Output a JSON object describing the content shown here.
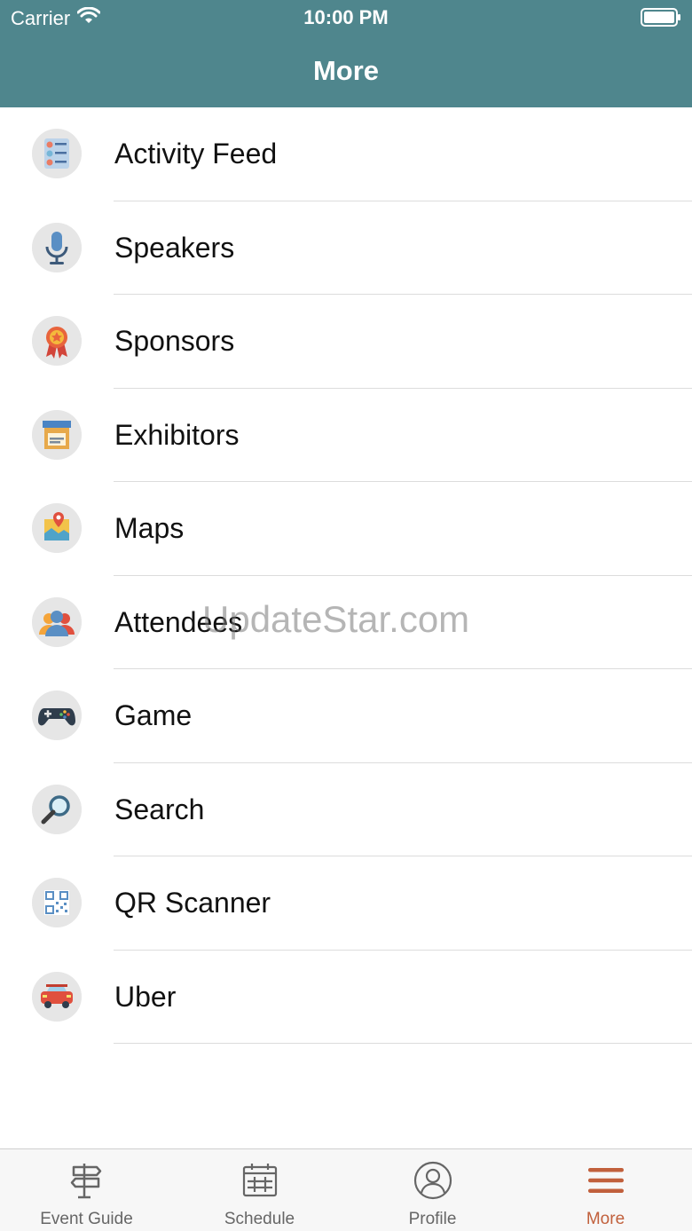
{
  "status_bar": {
    "carrier": "Carrier",
    "time": "10:00 PM"
  },
  "nav": {
    "title": "More"
  },
  "colors": {
    "header": "#4f868d",
    "active_tab": "#c1603c",
    "inactive_tab": "#666666"
  },
  "menu": {
    "items": [
      {
        "label": "Activity Feed",
        "icon": "activity-feed-icon"
      },
      {
        "label": "Speakers",
        "icon": "microphone-icon"
      },
      {
        "label": "Sponsors",
        "icon": "award-ribbon-icon"
      },
      {
        "label": "Exhibitors",
        "icon": "booth-icon"
      },
      {
        "label": "Maps",
        "icon": "map-pin-icon"
      },
      {
        "label": "Attendees",
        "icon": "people-icon"
      },
      {
        "label": "Game",
        "icon": "gamepad-icon"
      },
      {
        "label": "Search",
        "icon": "magnifier-icon"
      },
      {
        "label": "QR Scanner",
        "icon": "qr-code-icon"
      },
      {
        "label": "Uber",
        "icon": "car-icon"
      }
    ]
  },
  "watermark": "UpdateStar.com",
  "tabs": [
    {
      "label": "Event Guide",
      "icon": "signpost-icon",
      "active": false
    },
    {
      "label": "Schedule",
      "icon": "calendar-icon",
      "active": false
    },
    {
      "label": "Profile",
      "icon": "user-icon",
      "active": false
    },
    {
      "label": "More",
      "icon": "menu-icon",
      "active": true
    }
  ]
}
